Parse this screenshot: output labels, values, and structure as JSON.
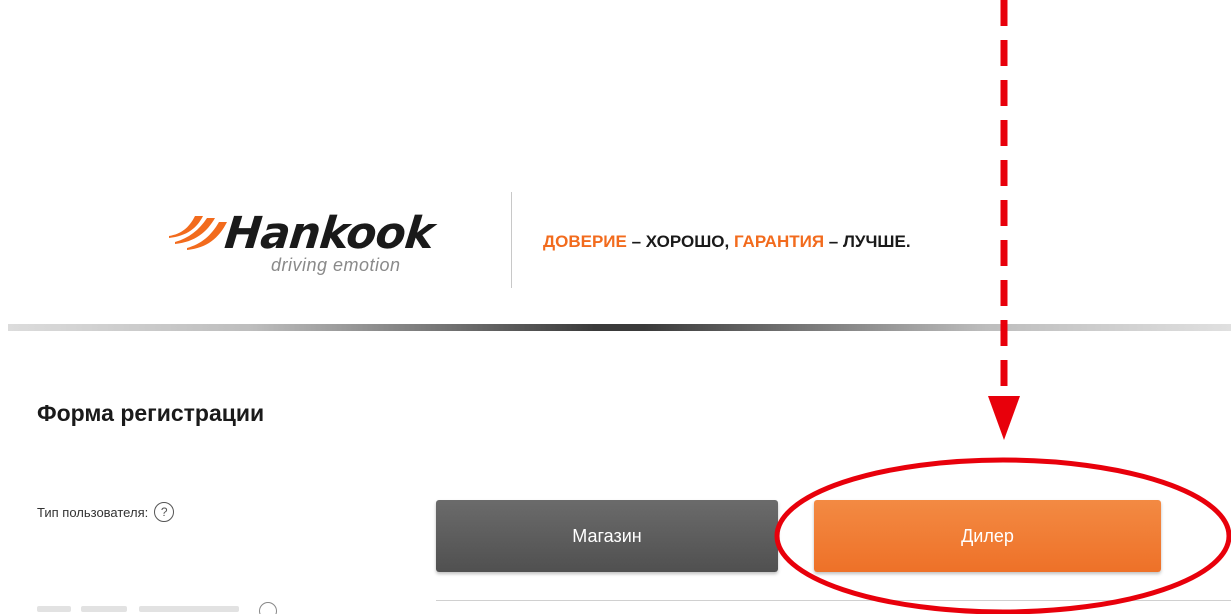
{
  "brand": {
    "name": "Hankook",
    "wordmark": "Hankook",
    "tagline": "driving emotion",
    "accent_color": "#f26b1d"
  },
  "slogan": {
    "part1": "ДОВЕРИЕ",
    "part2": " – ХОРОШО, ",
    "part3": "ГАРАНТИЯ",
    "part4": " – ЛУЧШЕ."
  },
  "form": {
    "title": "Форма регистрации",
    "user_type_label": "Тип пользователя:",
    "help_icon": "?",
    "options": {
      "shop": "Магазин",
      "dealer": "Дилер"
    },
    "colors": {
      "shop_button": "#5c5c5c",
      "dealer_button": "#f07a33"
    }
  },
  "annotation": {
    "color": "#e8000b",
    "arrow_icon": "dashed-arrow-down",
    "highlight_icon": "red-ellipse"
  }
}
